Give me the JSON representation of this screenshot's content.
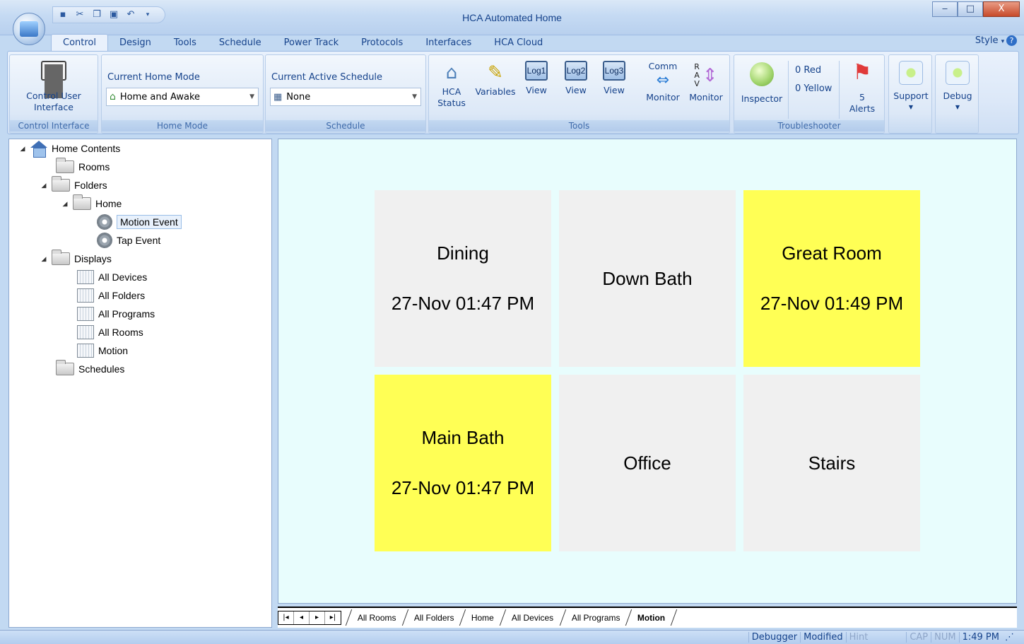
{
  "window": {
    "title": "HCA Automated Home",
    "controls": {
      "minimize": "‒",
      "maximize": "□",
      "close": "X"
    }
  },
  "ribbon": {
    "tabs": [
      {
        "label": "Control",
        "active": true
      },
      {
        "label": "Design"
      },
      {
        "label": "Tools"
      },
      {
        "label": "Schedule"
      },
      {
        "label": "Power Track"
      },
      {
        "label": "Protocols"
      },
      {
        "label": "Interfaces"
      },
      {
        "label": "HCA Cloud"
      }
    ],
    "style_menu": "Style",
    "groups": {
      "control_interface": {
        "label": "Control Interface",
        "button": "Control User Interface"
      },
      "home_mode": {
        "label": "Home Mode",
        "field_label": "Current Home Mode",
        "value": "Home and Awake"
      },
      "schedule": {
        "label": "Schedule",
        "field_label": "Current Active Schedule",
        "value": "None"
      },
      "tools": {
        "label": "Tools",
        "hca_status": "HCA Status",
        "variables": "Variables",
        "log1": {
          "icon_text": "Log1",
          "label": "View"
        },
        "log2": {
          "icon_text": "Log2",
          "label": "View"
        },
        "log3": {
          "icon_text": "Log3",
          "label": "View"
        },
        "comm_top": "Comm",
        "comm_monitor": "Monitor",
        "rav_letters": "R\nA\nV",
        "rav_monitor": "Monitor"
      },
      "troubleshooter": {
        "label": "Troubleshooter",
        "inspector": "Inspector",
        "red": "0 Red",
        "yellow": "0 Yellow",
        "alerts_count": "5",
        "alerts_label": "Alerts"
      },
      "support": "Support",
      "debug": "Debug"
    }
  },
  "tree": {
    "root": "Home Contents",
    "rooms": "Rooms",
    "folders": "Folders",
    "home": "Home",
    "motion_event": "Motion Event",
    "tap_event": "Tap Event",
    "displays": "Displays",
    "all_devices": "All Devices",
    "all_folders": "All Folders",
    "all_programs": "All Programs",
    "all_rooms": "All Rooms",
    "motion": "Motion",
    "schedules": "Schedules"
  },
  "tiles": [
    {
      "name": "Dining",
      "time": "27-Nov 01:47 PM",
      "color": "#f0f0f0"
    },
    {
      "name": "Down Bath",
      "time": "",
      "color": "#f0f0f0"
    },
    {
      "name": "Great Room",
      "time": "27-Nov 01:49 PM",
      "color": "#ffff55"
    },
    {
      "name": "Main Bath",
      "time": "27-Nov 01:47 PM",
      "color": "#ffff55"
    },
    {
      "name": "Office",
      "time": "",
      "color": "#f0f0f0"
    },
    {
      "name": "Stairs",
      "time": "",
      "color": "#f0f0f0"
    }
  ],
  "sheet_tabs": [
    "All Rooms",
    "All Folders",
    "Home",
    "All Devices",
    "All Programs",
    "Motion"
  ],
  "sheet_nav": [
    "|◂",
    "◂",
    "▸",
    "▸|"
  ],
  "status": {
    "debugger": "Debugger",
    "modified": "Modified",
    "hint": "Hint",
    "cap": "CAP",
    "num": "NUM",
    "time": "1:49 PM"
  }
}
